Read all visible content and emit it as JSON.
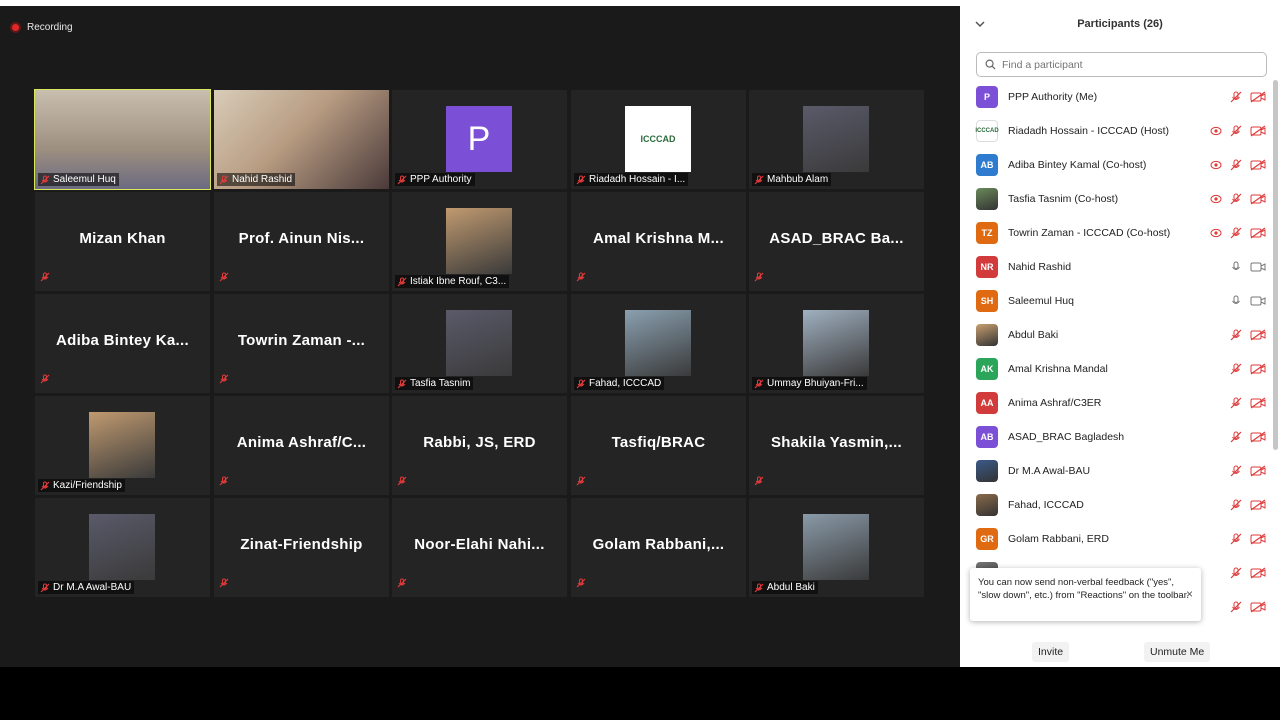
{
  "recording": {
    "label": "Recording"
  },
  "tiles": [
    {
      "name": "Saleemul Huq",
      "kind": "video",
      "active": true
    },
    {
      "name": "Nahid Rashid",
      "kind": "video"
    },
    {
      "name": "PPP Authority",
      "kind": "avatar",
      "letter": "P"
    },
    {
      "name": "Riadadh Hossain - I...",
      "kind": "logo",
      "logo_text": "ICCCAD"
    },
    {
      "name": "Mahbub Alam",
      "kind": "photo"
    },
    {
      "big": "Mizan Khan",
      "kind": "text"
    },
    {
      "big": "Prof. Ainun Nis...",
      "kind": "text"
    },
    {
      "name": "Istiak Ibne Rouf, C3...",
      "kind": "photo"
    },
    {
      "big": "Amal Krishna M...",
      "kind": "text"
    },
    {
      "big": "ASAD_BRAC Ba...",
      "kind": "text"
    },
    {
      "big": "Adiba Bintey Ka...",
      "kind": "text"
    },
    {
      "big": "Towrin Zaman -...",
      "kind": "text"
    },
    {
      "name": "Tasfia Tasnim",
      "kind": "photo"
    },
    {
      "name": "Fahad, ICCCAD",
      "kind": "photo"
    },
    {
      "name": "Ummay Bhuiyan-Fri...",
      "kind": "photo"
    },
    {
      "name": "Kazi/Friendship",
      "kind": "photo"
    },
    {
      "big": "Anima Ashraf/C...",
      "kind": "text"
    },
    {
      "big": "Rabbi, JS, ERD",
      "kind": "text"
    },
    {
      "big": "Tasfiq/BRAC",
      "kind": "text"
    },
    {
      "big": "Shakila Yasmin,...",
      "kind": "text"
    },
    {
      "name": "Dr M.A Awal-BAU",
      "kind": "photo"
    },
    {
      "big": "Zinat-Friendship",
      "kind": "text"
    },
    {
      "big": "Noor-Elahi Nahi...",
      "kind": "text"
    },
    {
      "big": "Golam Rabbani,...",
      "kind": "text"
    },
    {
      "name": "Abdul Baki",
      "kind": "photo"
    }
  ],
  "panel": {
    "title": "Participants (26)",
    "search_placeholder": "Find a participant",
    "participants": [
      {
        "initials": "P",
        "color": "#7b4fd6",
        "name": "PPP Authority (Me)",
        "rec": false,
        "mic": "off",
        "cam": "off"
      },
      {
        "initials": "",
        "color": "#ffffff",
        "name": "Riadadh Hossain - ICCCAD (Host)",
        "rec": true,
        "mic": "off",
        "cam": "off",
        "logo": true
      },
      {
        "initials": "AB",
        "color": "#2e7bcf",
        "name": "Adiba Bintey Kamal (Co-host)",
        "rec": true,
        "mic": "off",
        "cam": "off"
      },
      {
        "initials": "",
        "color": "#6a8a5a",
        "name": "Tasfia Tasnim (Co-host)",
        "rec": true,
        "mic": "off",
        "cam": "off",
        "photo": true
      },
      {
        "initials": "TZ",
        "color": "#e06a12",
        "name": "Towrin Zaman - ICCCAD (Co-host)",
        "rec": true,
        "mic": "off",
        "cam": "off"
      },
      {
        "initials": "NR",
        "color": "#d23b3b",
        "name": "Nahid Rashid",
        "rec": false,
        "mic": "on",
        "cam": "on"
      },
      {
        "initials": "SH",
        "color": "#e06a12",
        "name": "Saleemul Huq",
        "rec": false,
        "mic": "on",
        "cam": "on"
      },
      {
        "initials": "",
        "color": "#c8a070",
        "name": "Abdul Baki",
        "rec": false,
        "mic": "off",
        "cam": "off",
        "photo": true
      },
      {
        "initials": "AK",
        "color": "#2aa55a",
        "name": "Amal Krishna Mandal",
        "rec": false,
        "mic": "off",
        "cam": "off"
      },
      {
        "initials": "AA",
        "color": "#d23b3b",
        "name": "Anima Ashraf/C3ER",
        "rec": false,
        "mic": "off",
        "cam": "off"
      },
      {
        "initials": "AB",
        "color": "#7b4fd6",
        "name": "ASAD_BRAC Bagladesh",
        "rec": false,
        "mic": "off",
        "cam": "off"
      },
      {
        "initials": "",
        "color": "#3a5a8a",
        "name": "Dr M.A Awal-BAU",
        "rec": false,
        "mic": "off",
        "cam": "off",
        "photo": true
      },
      {
        "initials": "",
        "color": "#8a6a4a",
        "name": "Fahad, ICCCAD",
        "rec": false,
        "mic": "off",
        "cam": "off",
        "photo": true
      },
      {
        "initials": "GR",
        "color": "#e06a12",
        "name": "Golam Rabbani, ERD",
        "rec": false,
        "mic": "off",
        "cam": "off"
      },
      {
        "initials": "",
        "color": "#777777",
        "name": "",
        "rec": false,
        "mic": "off",
        "cam": "off",
        "photo": true
      },
      {
        "initials": "",
        "color": "#777777",
        "name": "",
        "rec": false,
        "mic": "off",
        "cam": "off",
        "hidden": true
      }
    ]
  },
  "tooltip": {
    "text": "You can now send non-verbal feedback (\"yes\", \"slow down\", etc.) from \"Reactions\" on the toolbar.",
    "close": "×"
  },
  "footer": {
    "invite": "Invite",
    "unmute": "Unmute Me"
  },
  "colors": {
    "mic_off": "#e03a3a",
    "active_border": "#d9e65a",
    "tile_bg": "#242424"
  }
}
